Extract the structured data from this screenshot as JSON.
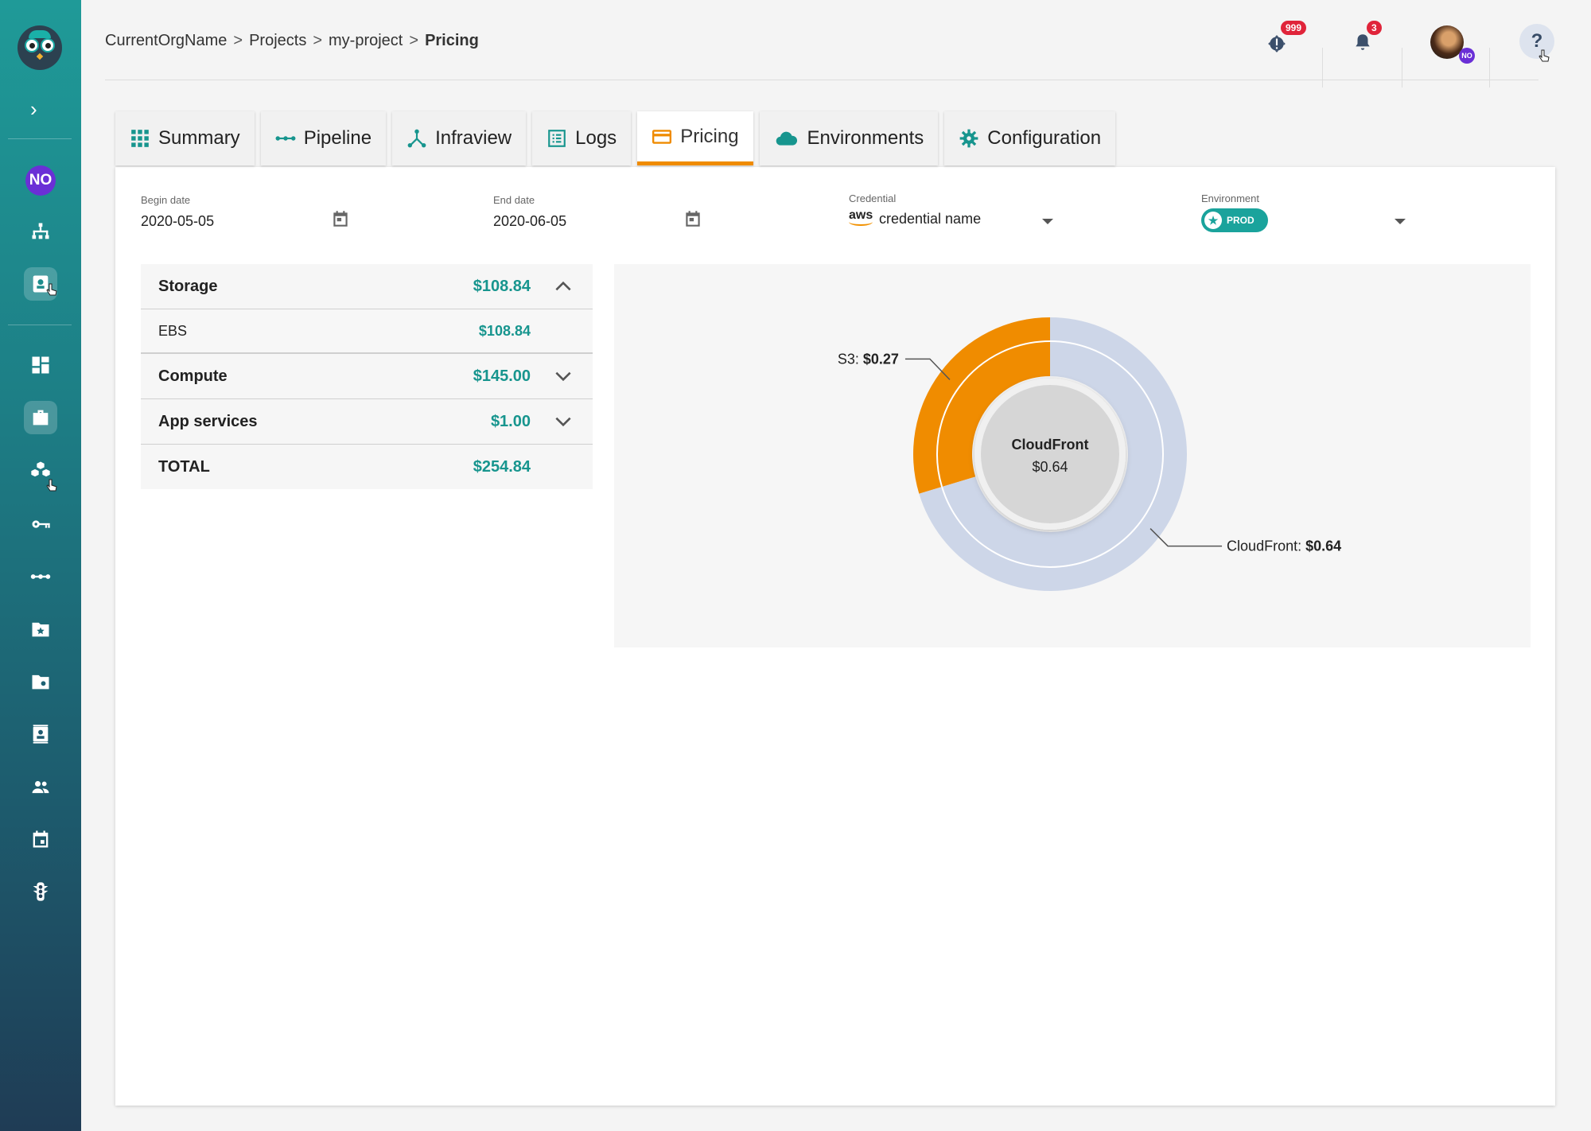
{
  "breadcrumb": {
    "org": "CurrentOrgName",
    "projects": "Projects",
    "project": "my-project",
    "current": "Pricing",
    "separator": ">"
  },
  "notifications": {
    "alerts_count": "999",
    "bell_count": "3"
  },
  "user": {
    "initials": "NO"
  },
  "help": {
    "label": "?"
  },
  "tabs": [
    {
      "label": "Summary",
      "icon": "grid-icon"
    },
    {
      "label": "Pipeline",
      "icon": "pipeline-icon"
    },
    {
      "label": "Infraview",
      "icon": "infraview-icon"
    },
    {
      "label": "Logs",
      "icon": "logs-icon"
    },
    {
      "label": "Pricing",
      "icon": "pricing-icon",
      "active": true
    },
    {
      "label": "Environments",
      "icon": "cloud-icon"
    },
    {
      "label": "Configuration",
      "icon": "gear-icon"
    }
  ],
  "filters": {
    "begin_date_label": "Begin date",
    "begin_date": "2020-05-05",
    "end_date_label": "End date",
    "end_date": "2020-06-05",
    "credential_label": "Credential",
    "credential_provider": "aws",
    "credential_value": "credential name",
    "environment_label": "Environment",
    "environment_value": "PROD"
  },
  "costs": {
    "storage": {
      "label": "Storage",
      "amount": "$108.84",
      "expanded": true
    },
    "ebs": {
      "label": "EBS",
      "amount": "$108.84"
    },
    "compute": {
      "label": "Compute",
      "amount": "$145.00"
    },
    "app_services": {
      "label": "App services",
      "amount": "$1.00"
    },
    "total": {
      "label": "TOTAL",
      "amount": "$254.84"
    }
  },
  "colors": {
    "accent": "#ef8b00",
    "teal": "#17958e",
    "s3_segment": "#f08c00",
    "cloudfront_segment": "#cdd6e8"
  },
  "chart_data": {
    "type": "pie",
    "center": {
      "title": "CloudFront",
      "value": "$0.64"
    },
    "slices": [
      {
        "name": "S3",
        "value": 0.27,
        "label_prefix": "S3: ",
        "label_value": "$0.27"
      },
      {
        "name": "CloudFront",
        "value": 0.64,
        "label_prefix": "CloudFront: ",
        "label_value": "$0.64"
      }
    ]
  }
}
